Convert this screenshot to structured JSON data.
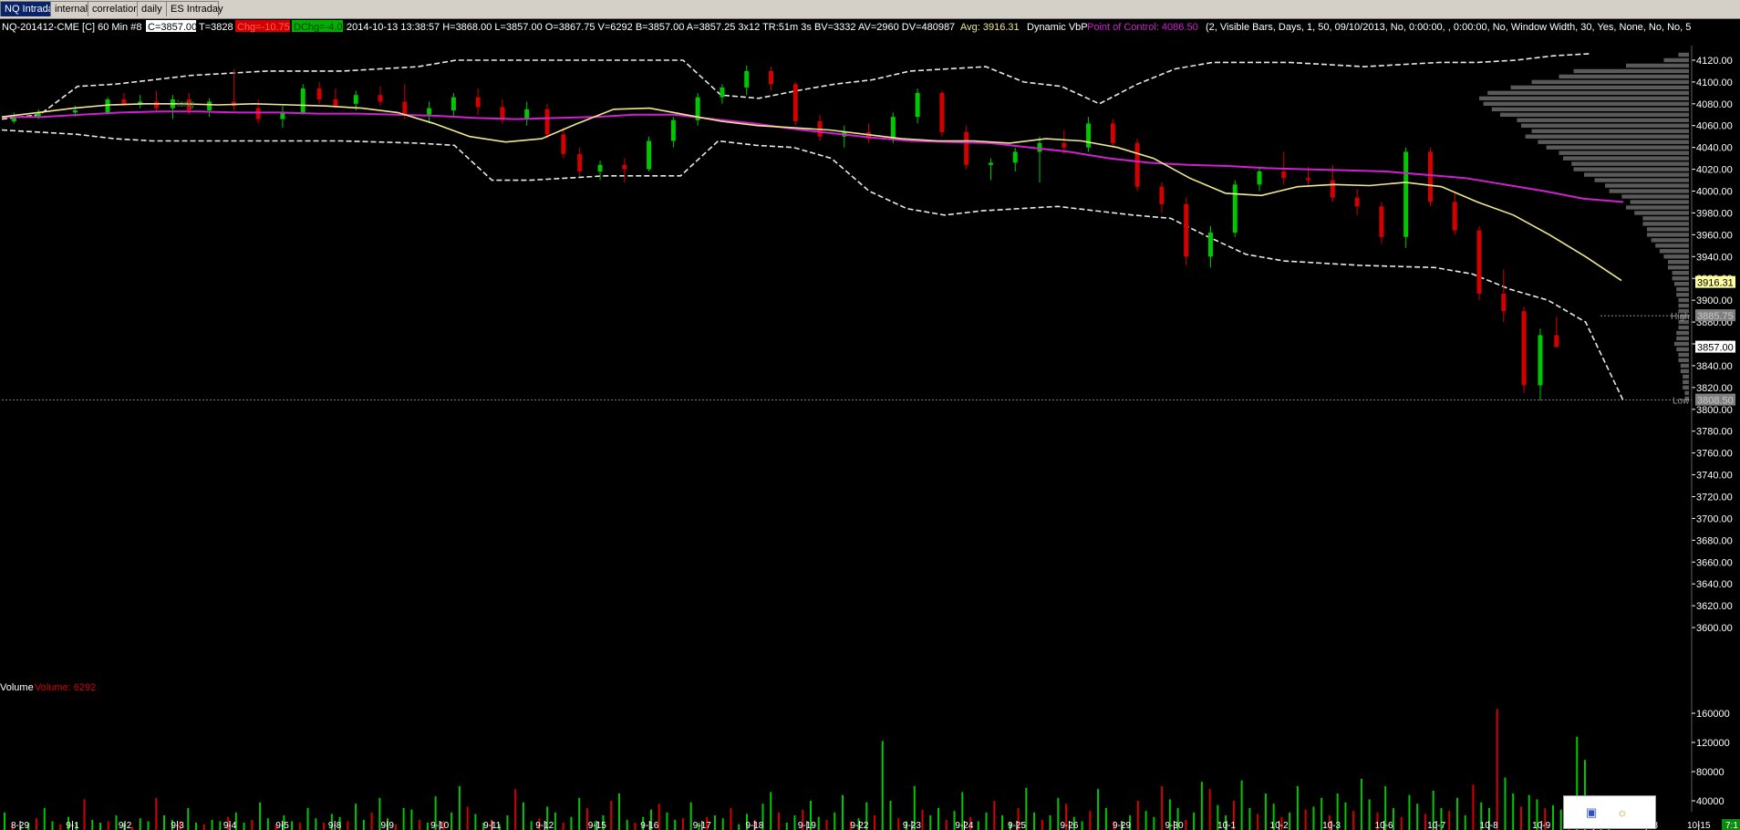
{
  "tabs": [
    "NQ Intraday",
    "internals",
    "correlations",
    "daily",
    "ES Intraday"
  ],
  "active_tab": 0,
  "header": {
    "symbol": "NQ-201412-CME [C]  60 Min   #8",
    "close": "C=3857.00",
    "tick": "T=3828",
    "chg": "Chg=-10.75",
    "dchg": "DChg=-4.00",
    "bar_info": "2014-10-13 13:38:57 H=3868.00 L=3857.00 O=3867.75 V=6292 B=3857.00 A=3857.25 3x12 TR:51m 3s BV=3332 AV=2960 DV=480987",
    "avg": "Avg: 3916.31",
    "study": "Dynamic VbP",
    "poc": "Point of Control: 4086.50",
    "params": "(2, Visible Bars, Days, 1, 50, 09/10/2013, No, 0:00:00, , 0:00:00, No, Window Width, 30, Yes, None, No, No, 5"
  },
  "colors": {
    "up": "#00c800",
    "down": "#d40000",
    "avg_line": "#f0e890",
    "poc_line": "#d020d0",
    "band": "#e8e8e8",
    "profile": "#6a6a6a",
    "label_tag": "#ffffa0",
    "trendline": "#4a7cff"
  },
  "annotations": {
    "high_label": "High",
    "high_value": "3885.75",
    "last_value": "3857.00",
    "low_label": "Low",
    "low_value": "3808.50",
    "avg_tag": "3916.31",
    "note_text": "long"
  },
  "volume": {
    "label": "Volume",
    "value_label": "Volume: 6292",
    "ticks": [
      "160000",
      "120000",
      "80000",
      "40000"
    ]
  },
  "corner": "7:1",
  "chart_data": {
    "type": "candlestick",
    "title": "NQ-201412-CME [C] 60 Min",
    "interval": "60 Min",
    "ylim": [
      3780,
      4130
    ],
    "y_ticks": [
      4120,
      4100,
      4080,
      4060,
      4040,
      4020,
      4000,
      3980,
      3960,
      3940,
      3920,
      3900,
      3880,
      3860,
      3840,
      3820,
      3800,
      3780,
      3760,
      3740,
      3720,
      3700,
      3680,
      3660,
      3640,
      3620,
      3600
    ],
    "x_ticks": [
      "8-29",
      "9-1",
      "9-2",
      "9-3",
      "9-4",
      "9-5",
      "9-8",
      "9-9",
      "9-10",
      "9-11",
      "9-12",
      "9-15",
      "9-16",
      "9-17",
      "9-18",
      "9-19",
      "9-22",
      "9-23",
      "9-24",
      "9-25",
      "9-26",
      "9-29",
      "9-30",
      "10-1",
      "10-2",
      "10-3",
      "10-6",
      "10-7",
      "10-8",
      "10-9",
      "10-10",
      "10-13",
      "10-15"
    ],
    "session_close": [
      4072,
      4074,
      4082,
      4082,
      4077,
      4072,
      4078,
      4082,
      4076,
      4077,
      4075,
      4072,
      4018,
      4020,
      4065,
      4075,
      4095,
      4115,
      4062,
      4050,
      4055,
      4070,
      4060,
      4028,
      4035,
      4045,
      4048,
      4040,
      4042,
      4000,
      3988,
      3955,
      4010,
      4018,
      4010,
      4025,
      4032,
      4040,
      4000,
      4002,
      3985,
      3975,
      3970,
      3958,
      3940,
      3900,
      3890,
      3858
    ],
    "sessions": [
      {
        "label": "8-29",
        "ohlc": [
          [
            4064,
            4072,
            4062,
            4068
          ],
          [
            4068,
            4075,
            4066,
            4072
          ]
        ]
      },
      {
        "label": "9-1",
        "ohlc": [
          [
            4072,
            4078,
            4068,
            4074
          ]
        ]
      },
      {
        "label": "9-2",
        "ohlc": [
          [
            4072,
            4086,
            4070,
            4084
          ],
          [
            4084,
            4090,
            4078,
            4080
          ],
          [
            4080,
            4088,
            4076,
            4082
          ]
        ]
      },
      {
        "label": "9-3",
        "ohlc": [
          [
            4082,
            4092,
            4072,
            4076
          ],
          [
            4076,
            4088,
            4066,
            4084
          ],
          [
            4084,
            4090,
            4070,
            4074
          ]
        ]
      },
      {
        "label": "9-4",
        "ohlc": [
          [
            4074,
            4085,
            4068,
            4082
          ],
          [
            4082,
            4112,
            4074,
            4078
          ]
        ]
      },
      {
        "label": "9-5",
        "ohlc": [
          [
            4076,
            4084,
            4062,
            4066
          ],
          [
            4066,
            4078,
            4058,
            4072
          ]
        ]
      },
      {
        "label": "9-8",
        "ohlc": [
          [
            4072,
            4098,
            4070,
            4094
          ],
          [
            4094,
            4100,
            4080,
            4084
          ],
          [
            4084,
            4094,
            4076,
            4078
          ]
        ]
      },
      {
        "label": "9-9",
        "ohlc": [
          [
            4080,
            4092,
            4074,
            4088
          ],
          [
            4088,
            4096,
            4078,
            4082
          ]
        ]
      },
      {
        "label": "9-10",
        "ohlc": [
          [
            4082,
            4098,
            4066,
            4070
          ],
          [
            4070,
            4082,
            4062,
            4076
          ]
        ]
      },
      {
        "label": "9-11",
        "ohlc": [
          [
            4074,
            4090,
            4068,
            4086
          ],
          [
            4086,
            4094,
            4070,
            4077
          ]
        ]
      },
      {
        "label": "9-12",
        "ohlc": [
          [
            4077,
            4084,
            4062,
            4066
          ],
          [
            4066,
            4082,
            4060,
            4075
          ]
        ]
      },
      {
        "label": "9-15",
        "ohlc": [
          [
            4075,
            4080,
            4048,
            4052
          ],
          [
            4052,
            4058,
            4030,
            4034
          ],
          [
            4034,
            4040,
            4014,
            4018
          ]
        ]
      },
      {
        "label": "9-16",
        "ohlc": [
          [
            4018,
            4028,
            4010,
            4024
          ],
          [
            4024,
            4030,
            4008,
            4020
          ]
        ]
      },
      {
        "label": "9-17",
        "ohlc": [
          [
            4020,
            4050,
            4018,
            4046
          ],
          [
            4046,
            4068,
            4040,
            4065
          ]
        ]
      },
      {
        "label": "9-18",
        "ohlc": [
          [
            4065,
            4090,
            4060,
            4086
          ],
          [
            4086,
            4098,
            4080,
            4095
          ]
        ]
      },
      {
        "label": "9-19",
        "ohlc": [
          [
            4095,
            4115,
            4088,
            4110
          ],
          [
            4110,
            4114,
            4092,
            4098
          ]
        ]
      },
      {
        "label": "9-22",
        "ohlc": [
          [
            4098,
            4100,
            4060,
            4064
          ],
          [
            4064,
            4070,
            4046,
            4050
          ]
        ]
      },
      {
        "label": "9-23",
        "ohlc": [
          [
            4050,
            4060,
            4040,
            4054
          ],
          [
            4054,
            4062,
            4044,
            4048
          ]
        ]
      },
      {
        "label": "9-24",
        "ohlc": [
          [
            4048,
            4072,
            4044,
            4068
          ],
          [
            4068,
            4094,
            4062,
            4090
          ]
        ]
      },
      {
        "label": "9-25",
        "ohlc": [
          [
            4090,
            4092,
            4050,
            4054
          ],
          [
            4054,
            4060,
            4020,
            4024
          ]
        ]
      },
      {
        "label": "9-26",
        "ohlc": [
          [
            4024,
            4030,
            4010,
            4026
          ],
          [
            4026,
            4040,
            4018,
            4036
          ]
        ]
      },
      {
        "label": "9-29",
        "ohlc": [
          [
            4036,
            4050,
            4008,
            4044
          ],
          [
            4044,
            4056,
            4034,
            4040
          ]
        ]
      },
      {
        "label": "9-30",
        "ohlc": [
          [
            4040,
            4068,
            4036,
            4062
          ],
          [
            4062,
            4066,
            4040,
            4044
          ]
        ]
      },
      {
        "label": "10-1",
        "ohlc": [
          [
            4044,
            4048,
            4000,
            4004
          ],
          [
            4004,
            4008,
            3980,
            3988
          ]
        ]
      },
      {
        "label": "10-2",
        "ohlc": [
          [
            3988,
            3994,
            3932,
            3940
          ],
          [
            3940,
            3968,
            3930,
            3962
          ]
        ]
      },
      {
        "label": "10-3",
        "ohlc": [
          [
            3962,
            4010,
            3958,
            4006
          ],
          [
            4006,
            4022,
            4000,
            4018
          ]
        ]
      },
      {
        "label": "10-6",
        "ohlc": [
          [
            4018,
            4036,
            4006,
            4012
          ],
          [
            4012,
            4022,
            4004,
            4010
          ]
        ]
      },
      {
        "label": "10-7",
        "ohlc": [
          [
            4010,
            4024,
            3990,
            3994
          ],
          [
            3994,
            4002,
            3978,
            3986
          ]
        ]
      },
      {
        "label": "10-8",
        "ohlc": [
          [
            3986,
            3990,
            3952,
            3958
          ],
          [
            3958,
            4040,
            3948,
            4036
          ]
        ]
      },
      {
        "label": "10-9",
        "ohlc": [
          [
            4036,
            4040,
            3986,
            3990
          ],
          [
            3990,
            3998,
            3960,
            3964
          ]
        ]
      },
      {
        "label": "10-10",
        "ohlc": [
          [
            3964,
            3968,
            3900,
            3906
          ],
          [
            3906,
            3928,
            3880,
            3890
          ]
        ]
      },
      {
        "label": "10-13",
        "ohlc": [
          [
            3890,
            3894,
            3815,
            3822
          ],
          [
            3822,
            3874,
            3808,
            3868
          ],
          [
            3868,
            3885,
            3857,
            3857
          ]
        ]
      }
    ],
    "avg_line": [
      4068,
      4072,
      4076,
      4079,
      4080,
      4080,
      4079,
      4080,
      4079,
      4078,
      4076,
      4072,
      4062,
      4050,
      4045,
      4048,
      4062,
      4075,
      4076,
      4070,
      4064,
      4060,
      4058,
      4056,
      4052,
      4048,
      4046,
      4046,
      4044,
      4048,
      4046,
      4040,
      4030,
      4012,
      3998,
      3996,
      4004,
      4006,
      4005,
      4008,
      4004,
      3990,
      3978,
      3960,
      3940,
      3918
    ],
    "poc_line": [
      4068,
      4068,
      4070,
      4072,
      4073,
      4073,
      4072,
      4072,
      4071,
      4071,
      4070,
      4069,
      4067,
      4066,
      4067,
      4068,
      4070,
      4070,
      4066,
      4062,
      4057,
      4053,
      4049,
      4046,
      4045,
      4044,
      4040,
      4036,
      4030,
      4026,
      4024,
      4023,
      4021,
      4020,
      4019,
      4018,
      4015,
      4012,
      4006,
      4000,
      3993,
      3990
    ],
    "upper_band": [
      4066,
      4070,
      4096,
      4098,
      4102,
      4106,
      4108,
      4110,
      4110,
      4110,
      4112,
      4114,
      4120,
      4120,
      4120,
      4120,
      4120,
      4120,
      4120,
      4088,
      4085,
      4092,
      4098,
      4102,
      4110,
      4112,
      4114,
      4100,
      4096,
      4080,
      4098,
      4112,
      4118,
      4118,
      4118,
      4116,
      4114,
      4116,
      4118,
      4118,
      4120,
      4124,
      4126
    ],
    "lower_band": [
      4056,
      4054,
      4052,
      4048,
      4046,
      4046,
      4046,
      4046,
      4046,
      4046,
      4045,
      4044,
      4042,
      4010,
      4010,
      4012,
      4014,
      4014,
      4014,
      4046,
      4042,
      4040,
      4030,
      4000,
      3984,
      3978,
      3982,
      3984,
      3986,
      3982,
      3978,
      3975,
      3958,
      3942,
      3936,
      3934,
      3932,
      3931,
      3930,
      3924,
      3910,
      3900,
      3880,
      3808
    ],
    "profile": [
      [
        4125,
        0.05
      ],
      [
        4120,
        0.12
      ],
      [
        4115,
        0.3
      ],
      [
        4110,
        0.55
      ],
      [
        4105,
        0.62
      ],
      [
        4100,
        0.75
      ],
      [
        4095,
        0.85
      ],
      [
        4090,
        0.96
      ],
      [
        4085,
        1.0
      ],
      [
        4080,
        0.98
      ],
      [
        4075,
        0.94
      ],
      [
        4070,
        0.9
      ],
      [
        4065,
        0.82
      ],
      [
        4060,
        0.8
      ],
      [
        4055,
        0.75
      ],
      [
        4050,
        0.78
      ],
      [
        4045,
        0.72
      ],
      [
        4040,
        0.68
      ],
      [
        4035,
        0.62
      ],
      [
        4030,
        0.6
      ],
      [
        4025,
        0.56
      ],
      [
        4020,
        0.55
      ],
      [
        4015,
        0.5
      ],
      [
        4010,
        0.45
      ],
      [
        4005,
        0.4
      ],
      [
        4000,
        0.38
      ],
      [
        3995,
        0.32
      ],
      [
        3990,
        0.28
      ],
      [
        3985,
        0.3
      ],
      [
        3980,
        0.26
      ],
      [
        3975,
        0.22
      ],
      [
        3970,
        0.22
      ],
      [
        3965,
        0.2
      ],
      [
        3960,
        0.2
      ],
      [
        3955,
        0.18
      ],
      [
        3950,
        0.16
      ],
      [
        3945,
        0.14
      ],
      [
        3940,
        0.12
      ],
      [
        3935,
        0.1
      ],
      [
        3930,
        0.1
      ],
      [
        3925,
        0.08
      ],
      [
        3920,
        0.08
      ],
      [
        3915,
        0.07
      ],
      [
        3910,
        0.06
      ],
      [
        3905,
        0.06
      ],
      [
        3900,
        0.05
      ],
      [
        3895,
        0.05
      ],
      [
        3890,
        0.05
      ],
      [
        3885,
        0.04
      ],
      [
        3880,
        0.05
      ],
      [
        3875,
        0.05
      ],
      [
        3870,
        0.06
      ],
      [
        3865,
        0.06
      ],
      [
        3860,
        0.07
      ],
      [
        3855,
        0.06
      ],
      [
        3850,
        0.05
      ],
      [
        3845,
        0.05
      ],
      [
        3840,
        0.04
      ],
      [
        3835,
        0.04
      ],
      [
        3830,
        0.03
      ],
      [
        3825,
        0.03
      ],
      [
        3820,
        0.03
      ],
      [
        3815,
        0.02
      ],
      [
        3810,
        0.02
      ]
    ],
    "volume_values": [
      24000,
      8000,
      4000,
      10000,
      16000,
      30000,
      12000,
      8000,
      18000,
      10000,
      42000,
      14000,
      10000,
      12000,
      20000,
      10000,
      4000,
      16000,
      12000,
      44000,
      20000,
      14000,
      12000,
      30000,
      10000,
      8000,
      14000,
      12000,
      18000,
      24000,
      10000,
      14000,
      38000,
      16000,
      8000,
      20000,
      12000,
      10000,
      30000,
      16000,
      10000,
      22000,
      18000,
      12000,
      36000,
      14000,
      24000,
      44000,
      16000,
      8000,
      30000,
      28000,
      14000,
      10000,
      46000,
      12000,
      24000,
      60000,
      32000,
      22000,
      10000,
      14000,
      8000,
      20000,
      56000,
      38000,
      12000,
      16000,
      32000,
      24000,
      10000,
      18000,
      44000,
      30000,
      12000,
      20000,
      40000,
      50000,
      14000,
      10000,
      18000,
      28000,
      36000,
      24000,
      14000,
      16000,
      38000,
      10000,
      18000,
      20000,
      16000,
      30000,
      8000,
      22000,
      14000,
      36000,
      52000,
      24000,
      10000,
      20000,
      28000,
      40000,
      18000,
      14000,
      24000,
      48000,
      12000,
      16000,
      38000,
      20000,
      122000,
      40000,
      16000,
      12000,
      60000,
      28000,
      20000,
      30000,
      14000,
      26000,
      52000,
      18000,
      12000,
      24000,
      40000,
      20000,
      10000,
      30000,
      58000,
      24000,
      14000,
      20000,
      44000,
      36000,
      18000,
      12000,
      26000,
      56000,
      30000,
      12000,
      10000,
      20000,
      40000,
      26000,
      18000,
      60000,
      42000,
      30000,
      14000,
      24000,
      66000,
      56000,
      34000,
      20000,
      40000,
      68000,
      30000,
      22000,
      50000,
      36000,
      18000,
      24000,
      60000,
      28000,
      32000,
      44000,
      20000,
      50000,
      38000,
      26000,
      70000,
      42000,
      24000,
      60000,
      30000,
      18000,
      48000,
      36000,
      22000,
      54000,
      30000,
      26000,
      44000,
      20000,
      62000,
      38000,
      30000,
      166000,
      72000,
      50000,
      32000,
      48000,
      42000,
      30000,
      34000,
      28000,
      22000,
      128000,
      96000,
      48000,
      30000,
      14000
    ]
  }
}
